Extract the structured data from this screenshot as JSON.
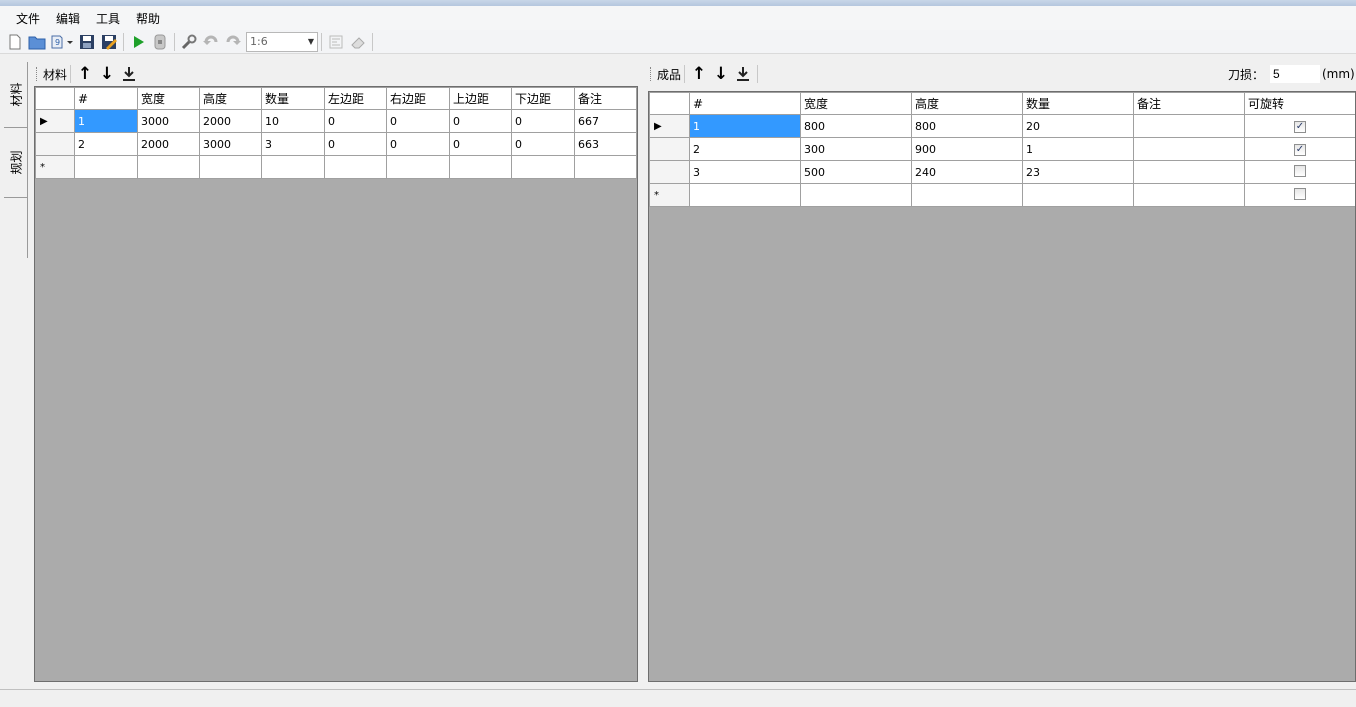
{
  "menu": [
    "文件",
    "编辑",
    "工具",
    "帮助"
  ],
  "toolbar": {
    "zoom": "1:6"
  },
  "side_tabs": [
    "材料",
    "规划"
  ],
  "materials": {
    "title": "材料",
    "columns": [
      "#",
      "宽度",
      "高度",
      "数量",
      "左边距",
      "右边距",
      "上边距",
      "下边距",
      "备注"
    ],
    "rows": [
      [
        "1",
        "3000",
        "2000",
        "10",
        "0",
        "0",
        "0",
        "0",
        "667"
      ],
      [
        "2",
        "2000",
        "3000",
        "3",
        "0",
        "0",
        "0",
        "0",
        "663"
      ]
    ],
    "new_row_marker": "*"
  },
  "products": {
    "title": "成品",
    "kerf_label": "刀损：",
    "kerf_value": "5",
    "kerf_unit": "(mm)",
    "columns": [
      "#",
      "宽度",
      "高度",
      "数量",
      "备注",
      "可旋转"
    ],
    "rows": [
      [
        "1",
        "800",
        "800",
        "20",
        "",
        true
      ],
      [
        "2",
        "300",
        "900",
        "1",
        "",
        true
      ],
      [
        "3",
        "500",
        "240",
        "23",
        "",
        false
      ]
    ],
    "new_row_marker": "*"
  }
}
